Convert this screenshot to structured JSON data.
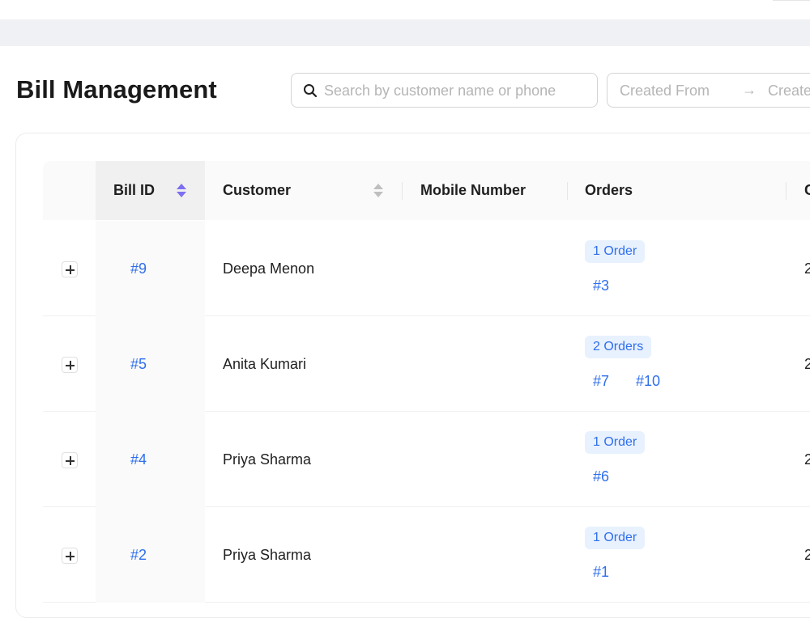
{
  "page": {
    "title": "Bill Management"
  },
  "search": {
    "placeholder": "Search by customer name or phone"
  },
  "date_range": {
    "from_placeholder": "Created From",
    "arrow": "→",
    "to_placeholder": "Create"
  },
  "table": {
    "columns": [
      "Bill ID",
      "Customer",
      "Mobile Number",
      "Orders",
      "C"
    ],
    "rows": [
      {
        "bill_id": "#9",
        "customer": "Deepa Menon",
        "mobile": "",
        "orders_count": "1 Order",
        "orders": [
          "#3"
        ],
        "next_col": "2"
      },
      {
        "bill_id": "#5",
        "customer": "Anita Kumari",
        "mobile": "",
        "orders_count": "2 Orders",
        "orders": [
          "#7",
          "#10"
        ],
        "next_col": "2"
      },
      {
        "bill_id": "#4",
        "customer": "Priya Sharma",
        "mobile": "",
        "orders_count": "1 Order",
        "orders": [
          "#6"
        ],
        "next_col": "2"
      },
      {
        "bill_id": "#2",
        "customer": "Priya Sharma",
        "mobile": "",
        "orders_count": "1 Order",
        "orders": [
          "#1"
        ],
        "next_col": "2"
      }
    ]
  },
  "colors": {
    "link": "#2f6fed",
    "tag_bg": "#e8f1fe",
    "sort_active": "#7c6ff2",
    "band": "#f0f1f5"
  }
}
